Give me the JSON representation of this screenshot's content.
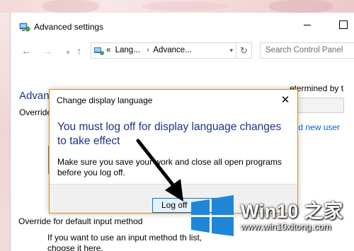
{
  "window": {
    "title": "Advanced settings",
    "controls": {
      "minimize": "minimize",
      "maximize": "maximize"
    }
  },
  "navbar": {
    "back_icon": "back-arrow-icon",
    "forward_icon": "forward-arrow-icon",
    "up_icon": "up-arrow-icon",
    "address": {
      "prefix": "«",
      "crumbs": [
        "Lang...",
        "Advance..."
      ]
    },
    "search_placeholder": "Search Control Panel"
  },
  "content": {
    "heading": "Advan",
    "section1_label": "Override",
    "partial_right_text": "etermined by t",
    "link_right": "and new user",
    "section2_label": "Override for default input method",
    "section2_desc": "If you want to use an input method th list, choose it here."
  },
  "dialog": {
    "title": "Change display language",
    "close_glyph": "✕",
    "heading": "You must log off for display language changes to take effect",
    "message": "Make sure you save your work and close all open programs before you log off.",
    "button_label": "Log off"
  },
  "watermark": {
    "title": "Win10 之家",
    "url": "www.win10xitong.com"
  },
  "colors": {
    "heading_blue": "#1e3287",
    "dialog_border": "#d88b23",
    "button_border": "#0078d7",
    "link": "#0066cc",
    "logo_blue": "#1f86d8"
  }
}
